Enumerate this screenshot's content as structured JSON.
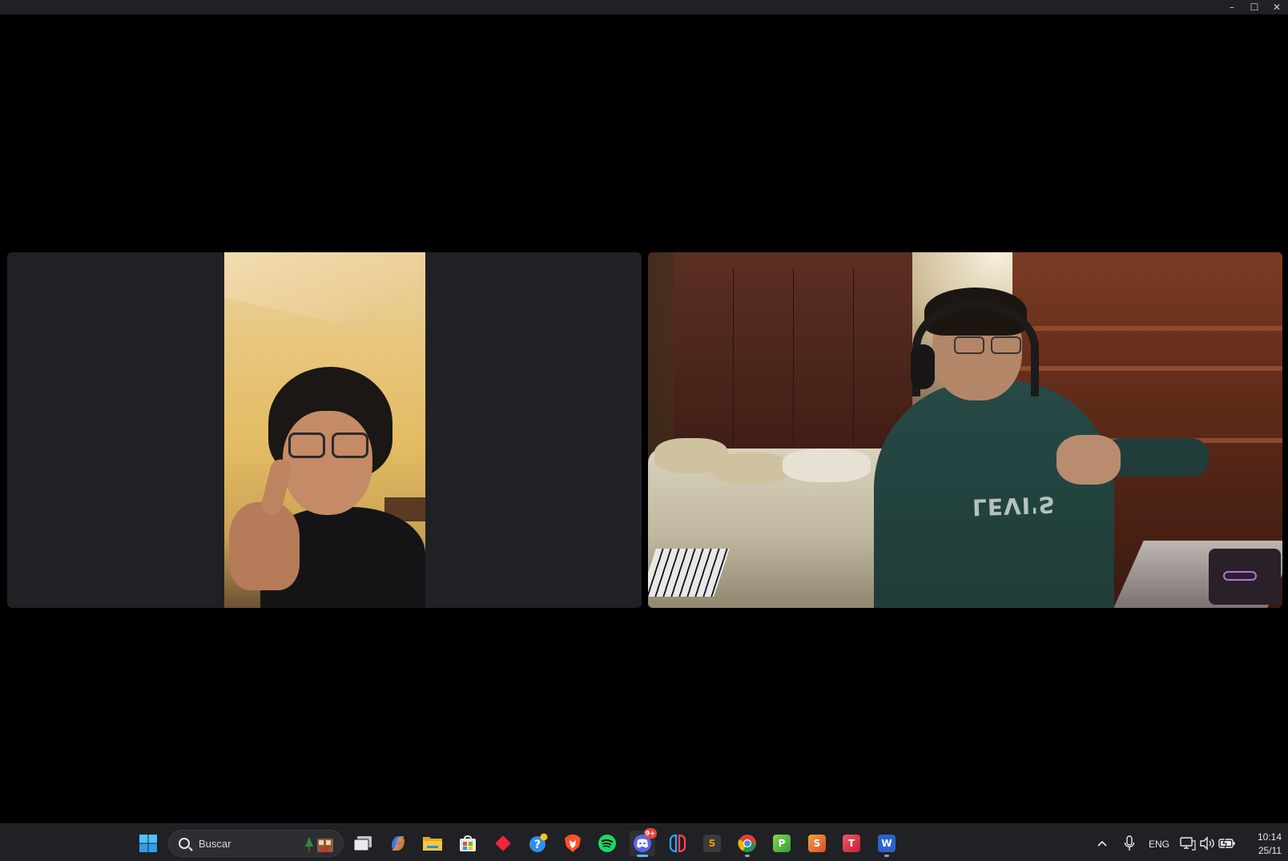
{
  "window": {
    "controls": {
      "minimize": "–",
      "maximize": "☐",
      "close": "✕"
    }
  },
  "call": {
    "participants": [
      {
        "id": "participant-1",
        "video_orientation": "portrait"
      },
      {
        "id": "participant-2",
        "video_orientation": "landscape",
        "shirt_text": "LEVI'S"
      }
    ]
  },
  "taskbar": {
    "search": {
      "placeholder": "Buscar"
    },
    "apps": [
      {
        "name": "start",
        "icon": "windows-start-icon"
      },
      {
        "name": "task-view",
        "icon": "task-view-icon"
      },
      {
        "name": "copilot",
        "icon": "copilot-icon"
      },
      {
        "name": "file-explorer",
        "icon": "folder-icon"
      },
      {
        "name": "microsoft-store",
        "icon": "store-icon"
      },
      {
        "name": "app-red-diamond",
        "icon": "red-diamond-icon"
      },
      {
        "name": "help",
        "icon": "help-icon"
      },
      {
        "name": "brave",
        "icon": "brave-icon"
      },
      {
        "name": "spotify",
        "icon": "spotify-icon"
      },
      {
        "name": "discord",
        "icon": "discord-icon",
        "badge": "9+"
      },
      {
        "name": "app-switch",
        "icon": "switch-icon"
      },
      {
        "name": "sublime-text",
        "icon": "sublime-icon",
        "glyph": "S"
      },
      {
        "name": "chrome",
        "icon": "chrome-icon"
      },
      {
        "name": "project",
        "icon": "project-icon",
        "glyph": "P"
      },
      {
        "name": "sway",
        "icon": "sway-icon",
        "glyph": "S"
      },
      {
        "name": "tool",
        "icon": "t-app-icon",
        "glyph": "T"
      },
      {
        "name": "word",
        "icon": "word-icon",
        "glyph": "W"
      }
    ],
    "tray": {
      "chevron": "^",
      "language": "ENG",
      "time": "10:14",
      "date": "25/11"
    }
  }
}
